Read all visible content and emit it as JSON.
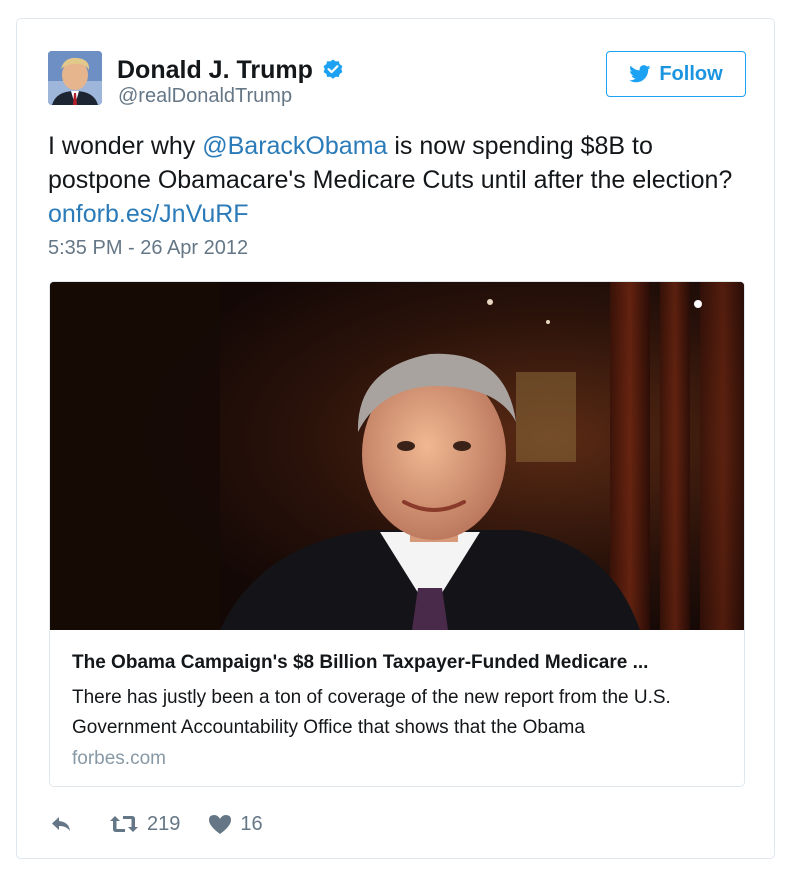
{
  "tweet": {
    "author_name": "Donald J. Trump",
    "handle": "@realDonaldTrump",
    "follow_label": "Follow",
    "text_before": "I wonder why ",
    "mention": "@BarackObama",
    "text_after": " is now spending $8B to postpone Obamacare's Medicare Cuts until after the election?",
    "link": "onforb.es/JnVuRF",
    "timestamp": "5:35 PM - 26 Apr 2012"
  },
  "card": {
    "title": "The Obama Campaign's $8 Billion Taxpayer-Funded Medicare ...",
    "description": "There has justly been a ton of coverage of the new report from the U.S. Government Accountability Office that shows that the Obama",
    "domain": "forbes.com"
  },
  "actions": {
    "retweets": "219",
    "likes": "16"
  },
  "colors": {
    "link": "#2b7bb9",
    "accent": "#1da1f2",
    "muted": "#657786",
    "border": "#e1e8ed"
  },
  "icons": [
    "verified-badge-icon",
    "twitter-bird-icon",
    "reply-icon",
    "retweet-icon",
    "heart-icon"
  ]
}
